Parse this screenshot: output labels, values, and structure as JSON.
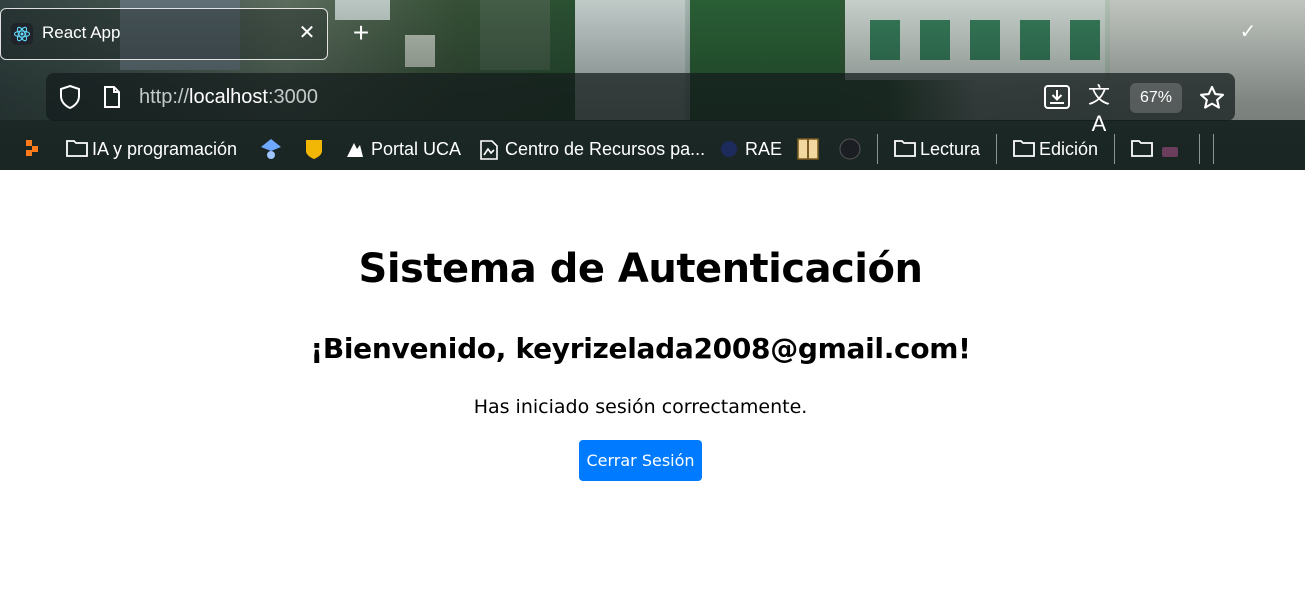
{
  "browser": {
    "tab": {
      "title": "React App",
      "close": "✕",
      "icon": "react-logo-icon"
    },
    "new_tab": "+",
    "window_control": "✓",
    "url": {
      "scheme": "http://",
      "host": "localhost",
      "port": ":3000"
    },
    "zoom": "67%",
    "translate_glyph": "文A",
    "bookmarks": [
      {
        "label": "IA y programación",
        "icon": "folder-icon"
      },
      {
        "label": "Portal UCA",
        "icon": "site-icon"
      },
      {
        "label": "Centro de Recursos pa...",
        "icon": "site-icon"
      },
      {
        "label": "RAE",
        "icon": "site-icon"
      },
      {
        "label": "Lectura",
        "icon": "folder-icon"
      },
      {
        "label": "Edición",
        "icon": "folder-icon"
      }
    ],
    "accent_colors": {
      "primary_button": "#007bff",
      "text": "#000000"
    }
  },
  "page": {
    "title": "Sistema de Autenticación",
    "welcome": "¡Bienvenido, keyrizelada2008@gmail.com!",
    "status": "Has iniciado sesión correctamente.",
    "logout_button": "Cerrar Sesión"
  }
}
